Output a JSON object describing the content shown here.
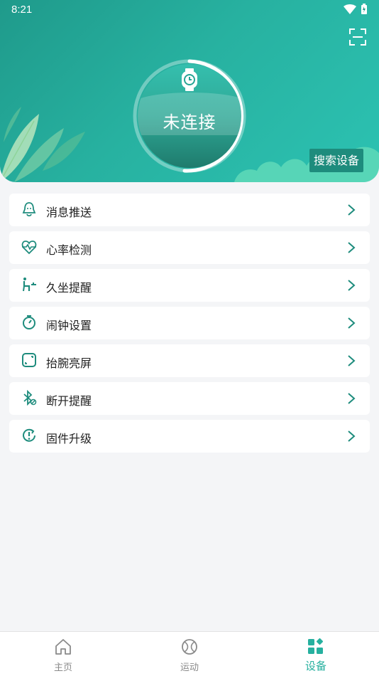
{
  "status_bar": {
    "time": "8:21"
  },
  "header": {
    "connection_status": "未连接",
    "search_button": "搜索设备",
    "accent_color": "#26b09f"
  },
  "menu": {
    "items": [
      {
        "label": "消息推送",
        "icon": "bell-icon"
      },
      {
        "label": "心率检测",
        "icon": "heart-rate-icon"
      },
      {
        "label": "久坐提醒",
        "icon": "sedentary-icon"
      },
      {
        "label": "闹钟设置",
        "icon": "stopwatch-icon"
      },
      {
        "label": "抬腕亮屏",
        "icon": "screen-wake-icon"
      },
      {
        "label": "断开提醒",
        "icon": "bluetooth-icon"
      },
      {
        "label": "固件升级",
        "icon": "firmware-icon"
      }
    ]
  },
  "tabbar": {
    "tabs": [
      {
        "label": "主页",
        "icon": "home-icon",
        "active": false
      },
      {
        "label": "运动",
        "icon": "ball-icon",
        "active": false
      },
      {
        "label": "设备",
        "icon": "device-grid-icon",
        "active": true
      }
    ]
  }
}
